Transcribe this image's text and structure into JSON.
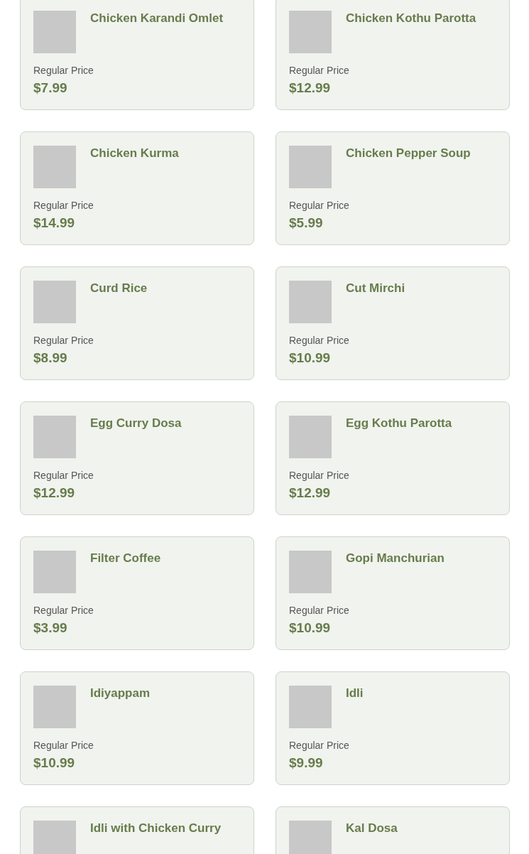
{
  "products": [
    {
      "name": "Chicken Karandi Omlet",
      "price_label": "Regular Price",
      "price": "$7.99"
    },
    {
      "name": "Chicken Kothu Parotta",
      "price_label": "Regular Price",
      "price": "$12.99"
    },
    {
      "name": "Chicken Kurma",
      "price_label": "Regular Price",
      "price": "$14.99"
    },
    {
      "name": "Chicken Pepper Soup",
      "price_label": "Regular Price",
      "price": "$5.99"
    },
    {
      "name": "Curd Rice",
      "price_label": "Regular Price",
      "price": "$8.99"
    },
    {
      "name": "Cut Mirchi",
      "price_label": "Regular Price",
      "price": "$10.99"
    },
    {
      "name": "Egg Curry Dosa",
      "price_label": "Regular Price",
      "price": "$12.99"
    },
    {
      "name": "Egg Kothu Parotta",
      "price_label": "Regular Price",
      "price": "$12.99"
    },
    {
      "name": "Filter Coffee",
      "price_label": "Regular Price",
      "price": "$3.99"
    },
    {
      "name": "Gopi Manchurian",
      "price_label": "Regular Price",
      "price": "$10.99"
    },
    {
      "name": "Idiyappam",
      "price_label": "Regular Price",
      "price": "$10.99"
    },
    {
      "name": "Idli",
      "price_label": "Regular Price",
      "price": "$9.99"
    },
    {
      "name": "Idli with Chicken Curry"
    },
    {
      "name": "Kal Dosa"
    }
  ]
}
